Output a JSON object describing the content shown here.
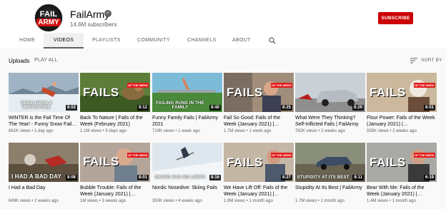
{
  "channel": {
    "name": "FailArmy",
    "subscribers": "14.6M subscribers",
    "avatar_line1": "FAIL",
    "avatar_line2": "ARMY",
    "subscribe_label": "SUBSCRIBE",
    "accent_color": "#cc0000"
  },
  "tabs": [
    {
      "label": "HOME"
    },
    {
      "label": "VIDEOS",
      "active": true
    },
    {
      "label": "PLAYLISTS"
    },
    {
      "label": "COMMUNITY"
    },
    {
      "label": "CHANNELS"
    },
    {
      "label": "ABOUT"
    }
  ],
  "search_icon": "search-icon",
  "toolbar": {
    "uploads_label": "Uploads",
    "play_all_label": "PLAY ALL",
    "sort_label": "SORT BY"
  },
  "videos": [
    {
      "title": "WINTER is the Fail Time Of The Year! - Funny Snow Fail…",
      "views": "881K views",
      "age": "1 day ago",
      "duration": "8:02",
      "caption": "ONCE UPON A WINTERTIME"
    },
    {
      "title": "Back To Nature | Fails of the Week (February 2021)",
      "views": "1.1M views",
      "age": "5 days ago",
      "duration": "8:12",
      "brand": "FAILS",
      "brand_tag": "OF THE WEEK"
    },
    {
      "title": "Funny Family Fails | FailArmy 2021",
      "views": "719K views",
      "age": "1 week ago",
      "duration": "8:40",
      "caption": "FAILING RUNS IN THE FAMILY"
    },
    {
      "title": "Fail So Good: Fails of the Week (January 2021) |…",
      "views": "1.7M views",
      "age": "1 week ago",
      "duration": "8:25",
      "brand": "FAILS",
      "brand_tag": "OF THE WEEK"
    },
    {
      "title": "What Were They Thinking? Self-Inflicted Fails | FailArmy",
      "views": "782K views",
      "age": "2 weeks ago",
      "duration": "8:29"
    },
    {
      "title": "Flour Power: Fails of the Week (January 2021) |…",
      "views": "935K views",
      "age": "2 weeks ago",
      "duration": "8:01",
      "brand": "FAILS",
      "brand_tag": "OF THE WEEK"
    },
    {
      "title": "I Had a Bad Day",
      "views": "649K views",
      "age": "2 weeks ago",
      "duration": "8:08",
      "caption": "I HAD A BAD DAY"
    },
    {
      "title": "Bubble Trouble: Fails of the Week (January 2021) |…",
      "views": "1M views",
      "age": "3 weeks ago",
      "duration": "8:01",
      "brand": "FAILS",
      "brand_tag": "OF THE WEEK"
    },
    {
      "title": "Nordic Nosedive: Skiing Fails",
      "views": "350K views",
      "age": "4 weeks ago",
      "duration": "8:16",
      "caption": "SKIING HAS NO LIMITS"
    },
    {
      "title": "We Have Lift Off: Fails of the Week (January 2021) |…",
      "views": "1.9M views",
      "age": "1 month ago",
      "duration": "8:27",
      "brand": "FAILS",
      "brand_tag": "OF THE WEEK"
    },
    {
      "title": "Stupidity At Its Best | FailArmy",
      "views": "1.7M views",
      "age": "1 month ago",
      "duration": "8:11",
      "caption": "STUPIDITY AT ITS BEST"
    },
    {
      "title": "Bear With Me: Fails of the Week (January 2021) |…",
      "views": "1.4M views",
      "age": "1 month ago",
      "duration": "6:19",
      "brand": "FAILS",
      "brand_tag": "OF THE WEEK"
    }
  ]
}
